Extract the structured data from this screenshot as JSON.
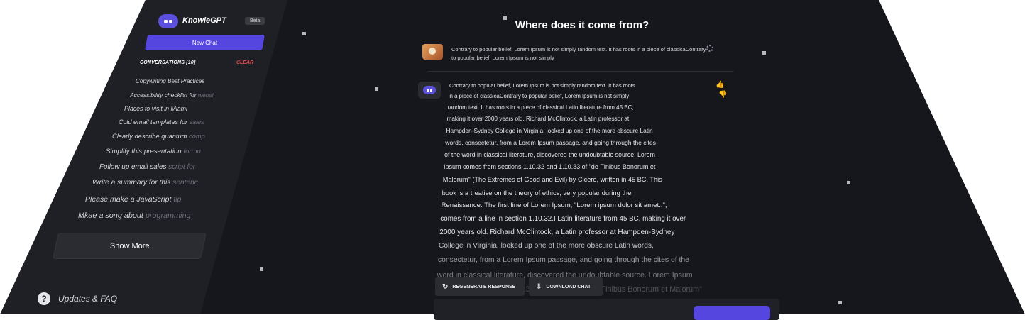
{
  "app": {
    "name": "KnowieGPT",
    "badge": "Beta"
  },
  "sidebar": {
    "new_chat_label": "New Chat",
    "conversations_label": "CONVERSATIONS [10]",
    "clear_label": "CLEAR",
    "items": [
      {
        "label": "Copywriting Best Practices",
        "faded": ""
      },
      {
        "label": "Accessibility checklist for ",
        "faded": "websi"
      },
      {
        "label": "Places to visit in Miami",
        "faded": ""
      },
      {
        "label": "Cold email templates for ",
        "faded": "sales"
      },
      {
        "label": "Clearly describe quantum ",
        "faded": "comp"
      },
      {
        "label": "Simplify this presentation ",
        "faded": "formu"
      },
      {
        "label": "Follow up email sales ",
        "faded": "script for"
      },
      {
        "label": "Write a summary for this ",
        "faded": "sentenc"
      },
      {
        "label": "Please make a JavaScript ",
        "faded": "tip"
      },
      {
        "label": "Mkae a song about ",
        "faded": "programming"
      }
    ],
    "show_more_label": "Show More",
    "footer_label": "Updates & FAQ",
    "footer_icon": "?"
  },
  "chat": {
    "title": "Where does it come from?",
    "user_message": "Contrary to popular belief, Lorem Ipsum is not simply random text. It has roots in a piece of classicaContrary to popular belief, Lorem Ipsum is not simply",
    "answer_lines": [
      "Contrary to popular belief, Lorem Ipsum is not simply random text. It has roots",
      "in a piece of classicaContrary to popular belief, Lorem Ipsum is not simply",
      "random text. It has roots in a piece of classical Latin literature from 45 BC,",
      "making it over 2000 years old. Richard McClintock, a Latin professor at",
      "Hampden-Sydney College in Virginia, looked up one of the more obscure Latin",
      "words, consectetur, from a Lorem Ipsum passage, and going through the cites",
      "of the word in classical literature, discovered the undoubtable source. Lorem",
      "Ipsum comes from sections 1.10.32 and 1.10.33 of \"de Finibus Bonorum et",
      "Malorum\" (The Extremes of Good and Evil) by Cicero, written in 45 BC. This",
      "book is a treatise on the theory of ethics, very popular during the",
      "Renaissance. The first line of Lorem Ipsum, \"Lorem ipsum dolor sit amet..\",",
      "comes from a line in section 1.10.32.I Latin literature from 45 BC, making it over",
      "2000 years old. Richard McClintock, a Latin professor at Hampden-Sydney",
      "College in Virginia, looked up one of the more obscure Latin words,",
      "consectetur, from a Lorem Ipsum passage, and going through the cites of the",
      "word in classical literature, discovered the undoubtable source. Lorem Ipsum",
      "comes from sections 1.10.32 and 1.10.33 of \"de Finibus Bonorum et Malorum\""
    ],
    "regenerate_label": "REGENERATE RESPONSE",
    "download_label": "DOWNLOAD CHAT"
  }
}
